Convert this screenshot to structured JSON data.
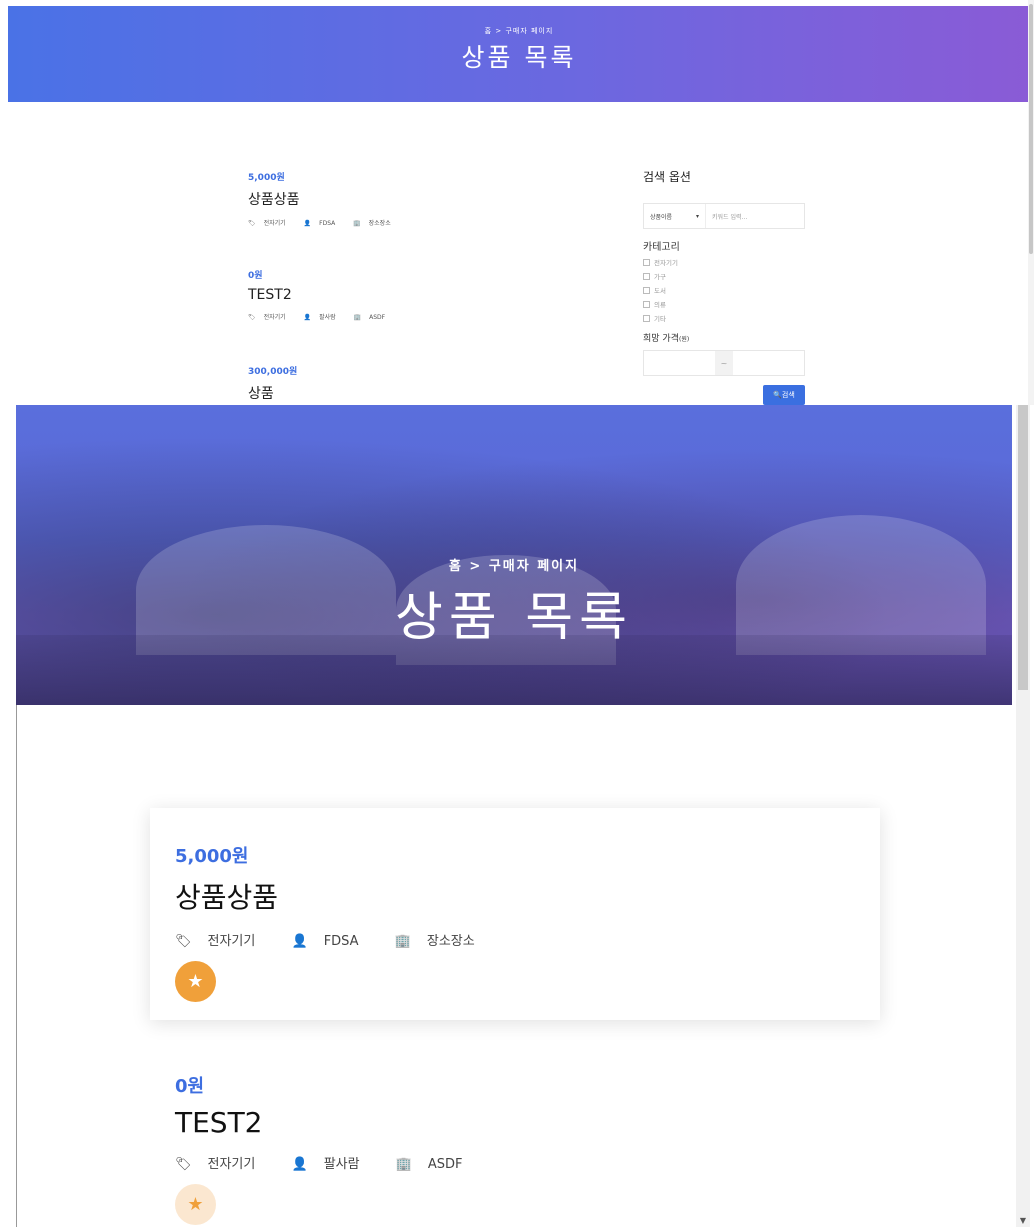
{
  "header": {
    "breadcrumb_home": "홈 >",
    "breadcrumb_current": "구매자 페이지",
    "title": "상품 목록"
  },
  "products": [
    {
      "price": "5,000원",
      "name": "상품상품",
      "category": "전자기기",
      "seller": "FDSA",
      "location": "장소장소",
      "favorite": true
    },
    {
      "price": "0원",
      "name": "TEST2",
      "category": "전자기기",
      "seller": "팔사람",
      "location": "ASDF",
      "favorite": false
    },
    {
      "price": "300,000원",
      "name": "상품"
    }
  ],
  "sidebar": {
    "title": "검색 옵션",
    "search_field_selected": "상품이름",
    "keyword_placeholder": "키워드 입력...",
    "category_title": "카테고리",
    "categories": [
      "전자기기",
      "가구",
      "도서",
      "의류",
      "기타"
    ],
    "price_title": "희망 가격",
    "price_unit": "(원)",
    "range_separator": "~",
    "search_button": "검색"
  },
  "icons": {
    "tag": "tag-icon",
    "user": "user-icon",
    "building": "building-icon",
    "star": "star-icon",
    "search": "search-icon"
  },
  "colors": {
    "accent": "#3d6ee0",
    "hero_start": "#4a72e6",
    "hero_end": "#8a5bd6",
    "star": "#f0a03a"
  }
}
